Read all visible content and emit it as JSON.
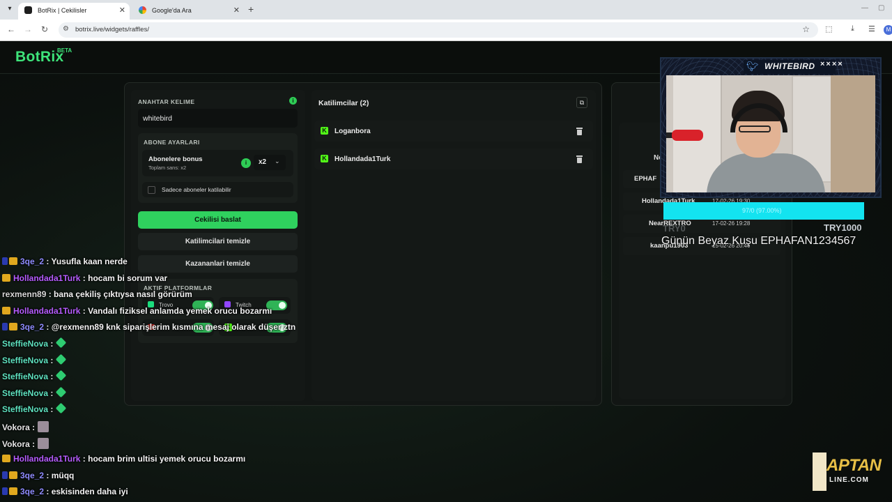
{
  "browser": {
    "tabs": [
      {
        "title": "BotRix | Cekilisler",
        "active": true
      },
      {
        "title": "Google'da Ara",
        "active": false
      }
    ],
    "url": "botrix.live/widgets/raffles/",
    "profile_initial": "M"
  },
  "site": {
    "logo": "BotRix",
    "badge": "BETA"
  },
  "settings": {
    "keyword_label": "ANAHTAR KELIME",
    "keyword_value": "whitebird",
    "sub_settings_label": "ABONE AYARLARI",
    "sub_bonus_title": "Abonelere bonus",
    "sub_bonus_sub": "Toplam sans: x2",
    "multiplier": "x2",
    "only_subs_label": "Sadece aboneler katilabilir",
    "start_button": "Cekilisi baslat",
    "clear_participants_button": "Katilimcilari temizle",
    "clear_winners_button": "Kazananlari temizle",
    "platforms_label": "AKTIF PLATFORMLAR",
    "platforms": [
      {
        "name": "Trovo"
      },
      {
        "name": "Twitch"
      }
    ]
  },
  "participants": {
    "title": "Katilimcilar (2)",
    "items": [
      {
        "name": "Loganbora"
      },
      {
        "name": "Hollandada1Turk"
      }
    ]
  },
  "winners": {
    "header_partial": "Ne",
    "items": [
      {
        "name": "EPHAF",
        "date": ""
      },
      {
        "name": "Hollandada1Turk",
        "date": "17-02-26 19:30"
      },
      {
        "name": "NearREXTRO",
        "date": "17-02-26 19:28"
      },
      {
        "name": "kaanpu1903",
        "date": "15-02-26 20:46"
      }
    ]
  },
  "overlay": {
    "cam_title": "WHITEBIRD",
    "goal_text": "97/0 (97.00%)",
    "goal_left": "TRY0",
    "goal_right": "TRY1000",
    "guest_line": "Günün Beyaz Kuşu EPHAFAN1234567",
    "brand_main": "APTAN",
    "brand_sub": "LINE.COM"
  },
  "chat": [
    {
      "badges": [
        "blue2",
        "gold"
      ],
      "user": "3qe_2",
      "color": "#8f8cff",
      "text": " : Yusufla kaan nerde",
      "emote": ""
    },
    {
      "badges": [
        "gold"
      ],
      "user": "Hollandada1Turk",
      "color": "#b65cff",
      "text": " : hocam bi sorum var",
      "emote": ""
    },
    {
      "badges": [],
      "user": "rexmenn89",
      "color": "#d8d8d8",
      "text": " : bana çekiliş çıktıysa nasıl görürüm",
      "emote": ""
    },
    {
      "badges": [
        "gold"
      ],
      "user": "Hollandada1Turk",
      "color": "#b65cff",
      "text": " : Vandalı fiziksel anlamda yemek orucu bozarmı",
      "emote": ""
    },
    {
      "badges": [
        "blue2",
        "gold"
      ],
      "user": "3qe_2",
      "color": "#8f8cff",
      "text": " : @rexmenn89 knk siparişlerim kısmına mesaj olarak düşer ztn",
      "emote": ""
    },
    {
      "badges": [],
      "user": "SteffieNova",
      "color": "#5fe3c0",
      "text": " :",
      "emote": "gem"
    },
    {
      "badges": [],
      "user": "SteffieNova",
      "color": "#5fe3c0",
      "text": " :",
      "emote": "gem"
    },
    {
      "badges": [],
      "user": "SteffieNova",
      "color": "#5fe3c0",
      "text": " :",
      "emote": "gem"
    },
    {
      "badges": [],
      "user": "SteffieNova",
      "color": "#5fe3c0",
      "text": " :",
      "emote": "gem"
    },
    {
      "badges": [],
      "user": "SteffieNova",
      "color": "#5fe3c0",
      "text": " :",
      "emote": "gem"
    },
    {
      "badges": [],
      "user": "Vokora",
      "color": "#e6e6e6",
      "text": " :",
      "emote": "avatar"
    },
    {
      "badges": [],
      "user": "Vokora",
      "color": "#e6e6e6",
      "text": " :",
      "emote": "avatar"
    },
    {
      "badges": [
        "gold"
      ],
      "user": "Hollandada1Turk",
      "color": "#b65cff",
      "text": " : hocam brim ultisi yemek orucu bozarmı",
      "emote": ""
    },
    {
      "badges": [
        "blue2",
        "gold"
      ],
      "user": "3qe_2",
      "color": "#8f8cff",
      "text": " : müqq",
      "emote": ""
    },
    {
      "badges": [
        "blue2",
        "gold"
      ],
      "user": "3qe_2",
      "color": "#8f8cff",
      "text": " : eskisinden daha iyi",
      "emote": ""
    }
  ]
}
